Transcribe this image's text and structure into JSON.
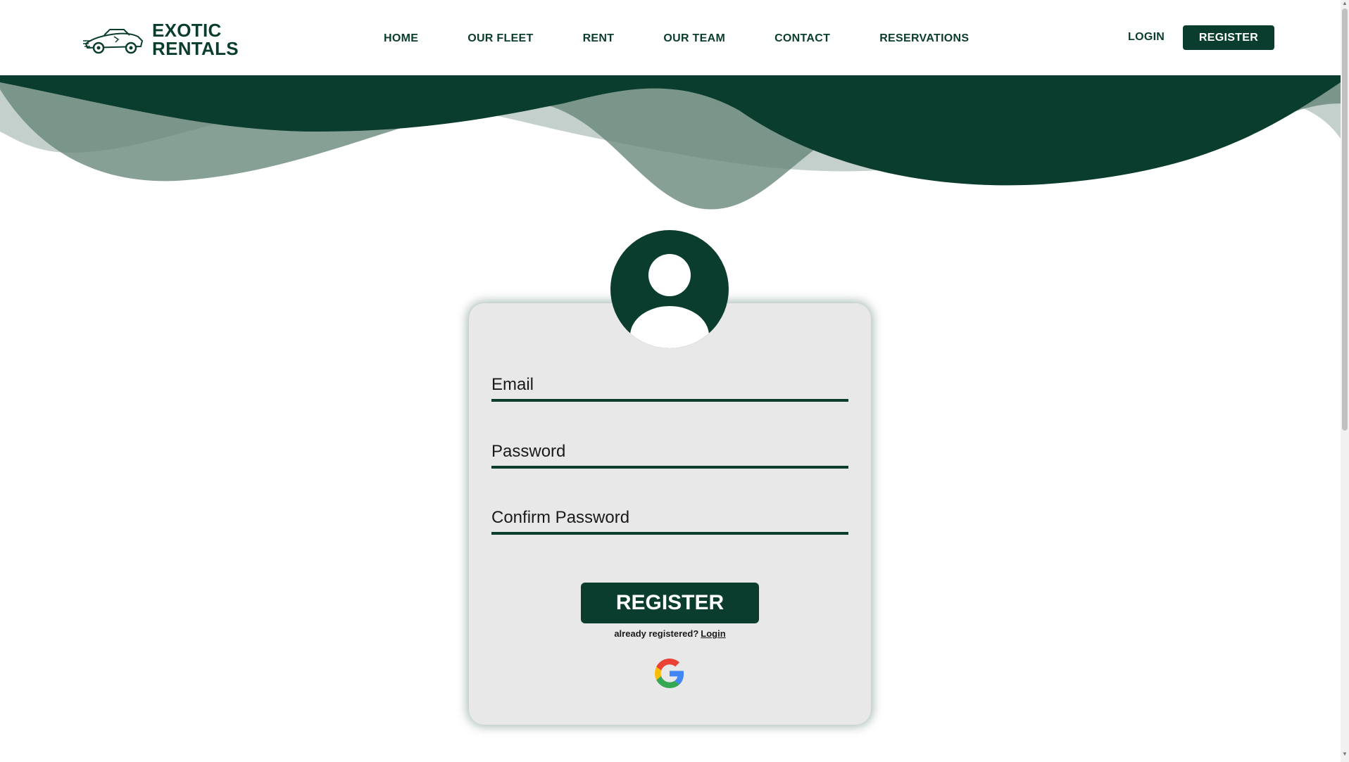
{
  "brand": {
    "name_line1": "EXOTIC",
    "name_line2": "RENTALS",
    "icon": "sports-car-logo-icon",
    "color": "#0b3d2e"
  },
  "nav": {
    "links": [
      "HOME",
      "OUR FLEET",
      "RENT",
      "OUR TEAM",
      "CONTACT",
      "RESERVATIONS"
    ],
    "login_label": "LOGIN",
    "register_label": "REGISTER"
  },
  "form": {
    "avatar_icon": "user-avatar-icon",
    "email_placeholder": "Email",
    "password_placeholder": "Password",
    "confirm_placeholder": "Confirm Password",
    "submit_label": "REGISTER",
    "already_text": "already registered?",
    "login_link": "Login",
    "google_icon": "google-icon"
  },
  "colors": {
    "accent": "#0b3d2e",
    "card": "#e8e8e8",
    "wave_mid": "#658579",
    "wave_light": "#c3d0cc"
  }
}
